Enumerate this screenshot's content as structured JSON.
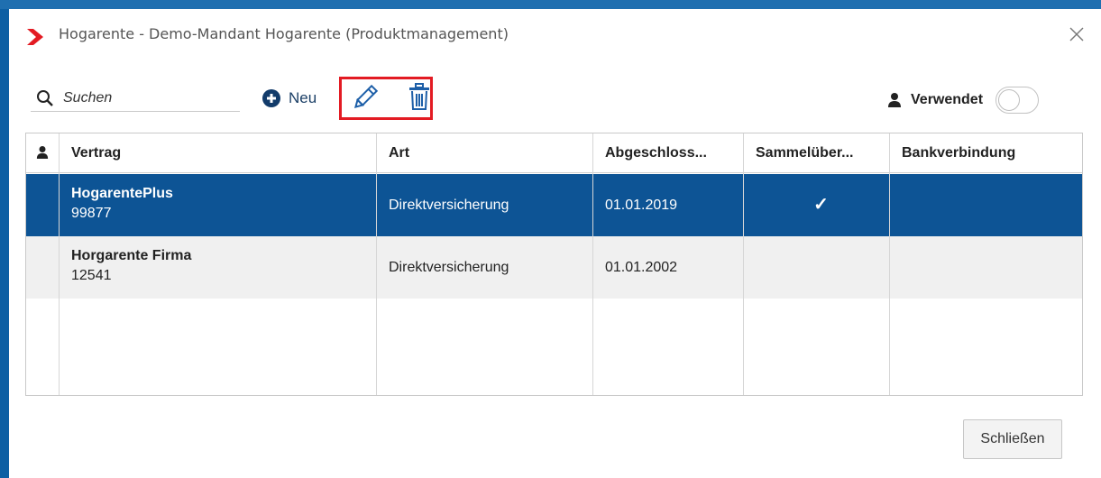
{
  "window": {
    "title": "Hogarente - Demo-Mandant Hogarente (Produktmanagement)",
    "accent_color": "#e31b23",
    "frame_color": "#0d5fa3"
  },
  "toolbar": {
    "search_placeholder": "Suchen",
    "new_label": "Neu",
    "edit_icon": "pencil-icon",
    "delete_icon": "trash-icon",
    "used_label": "Verwendet",
    "used_toggle_on": false
  },
  "table": {
    "columns": [
      "Vertrag",
      "Art",
      "Abgeschloss...",
      "Sammelüber...",
      "Bankverbindung"
    ],
    "selected_color": "#0d5495",
    "rows": [
      {
        "name": "HogarentePlus",
        "number": "99877",
        "art": "Direktversicherung",
        "date": "01.01.2019",
        "sammel": "✓",
        "bank": "",
        "selected": true
      },
      {
        "name": "Horgarente Firma",
        "number": "12541",
        "art": "Direktversicherung",
        "date": "01.01.2002",
        "sammel": "",
        "bank": "",
        "selected": false
      }
    ]
  },
  "footer": {
    "close_label": "Schließen"
  }
}
